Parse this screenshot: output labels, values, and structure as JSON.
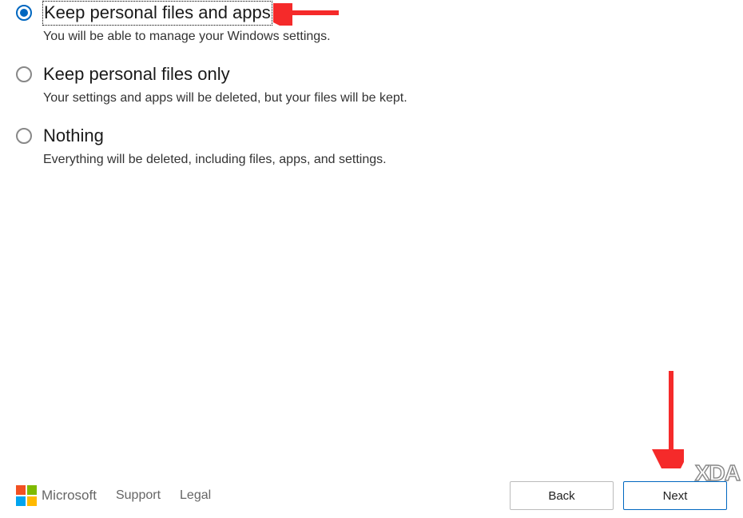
{
  "options": [
    {
      "title": "Keep personal files and apps",
      "description": "You will be able to manage your Windows settings.",
      "selected": true,
      "focused": true
    },
    {
      "title": "Keep personal files only",
      "description": "Your settings and apps will be deleted, but your files will be kept.",
      "selected": false,
      "focused": false
    },
    {
      "title": "Nothing",
      "description": "Everything will be deleted, including files, apps, and settings.",
      "selected": false,
      "focused": false
    }
  ],
  "footer": {
    "brand": "Microsoft",
    "support_link": "Support",
    "legal_link": "Legal"
  },
  "buttons": {
    "back": "Back",
    "next": "Next"
  },
  "annotations": {
    "arrow_color": "#f52a2a"
  },
  "watermark": "XDA"
}
